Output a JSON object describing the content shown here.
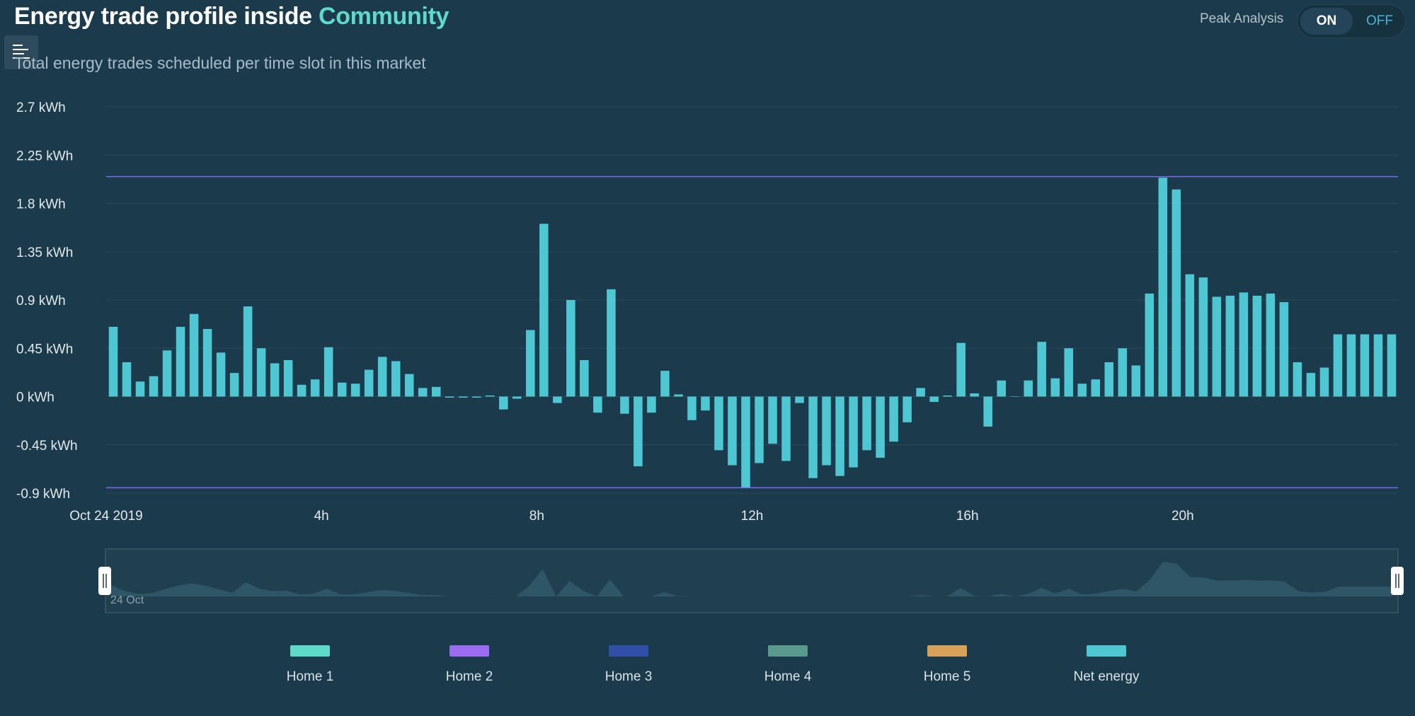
{
  "header": {
    "title_prefix": "Energy trade profile inside",
    "title_community": "Community",
    "subtitle": "Total energy trades scheduled per time slot in this market"
  },
  "peak_analysis": {
    "label": "Peak Analysis",
    "on_label": "ON",
    "off_label": "OFF",
    "state": "ON"
  },
  "colors": {
    "background": "#1b3a4b",
    "net_energy": "#4fc7d2",
    "peak_line": "#7c6cf2",
    "title_accent": "#5fd9c8"
  },
  "icons": {
    "menu": "menu-icon"
  },
  "chart_data": {
    "type": "bar",
    "title": "",
    "xlabel": "",
    "ylabel": "",
    "ylim": [
      -0.9,
      2.7
    ],
    "y_ticks": [
      "2.7 kWh",
      "2.25 kWh",
      "1.8 kWh",
      "1.35 kWh",
      "0.9 kWh",
      "0.45 kWh",
      "0 kWh",
      "-0.45 kWh",
      "-0.9 kWh"
    ],
    "y_tick_values": [
      2.7,
      2.25,
      1.8,
      1.35,
      0.9,
      0.45,
      0,
      -0.45,
      -0.9
    ],
    "x_ticks": [
      "Oct 24 2019",
      "4h",
      "8h",
      "12h",
      "16h",
      "20h"
    ],
    "x_tick_hours": [
      0,
      4,
      8,
      12,
      16,
      20
    ],
    "x_range_hours": [
      0,
      24
    ],
    "peak_lines": [
      2.05,
      -0.85
    ],
    "grid": true,
    "legend_position": "bottom",
    "series": [
      {
        "name": "Net energy",
        "start_hour": 0,
        "slot_hours": 0.25,
        "values": [
          0.65,
          0.32,
          0.14,
          0.19,
          0.43,
          0.65,
          0.77,
          0.63,
          0.41,
          0.22,
          0.84,
          0.45,
          0.31,
          0.34,
          0.11,
          0.16,
          0.46,
          0.13,
          0.12,
          0.25,
          0.37,
          0.33,
          0.21,
          0.08,
          0.09,
          -0.01,
          -0.01,
          -0.01,
          0.01,
          -0.12,
          -0.02,
          0.62,
          1.61,
          -0.06,
          0.9,
          0.34,
          -0.15,
          1.0,
          -0.16,
          -0.65,
          -0.15,
          0.24,
          0.02,
          -0.22,
          -0.13,
          -0.5,
          -0.64,
          -0.85,
          -0.62,
          -0.44,
          -0.6,
          -0.06,
          -0.76,
          -0.64,
          -0.74,
          -0.66,
          -0.5,
          -0.57,
          -0.42,
          -0.24,
          0.08,
          -0.05,
          0.01,
          0.5,
          0.03,
          -0.28,
          0.15,
          0,
          0.15,
          0.51,
          0.17,
          0.45,
          0.12,
          0.16,
          0.32,
          0.45,
          0.29,
          0.96,
          2.04,
          1.93,
          1.14,
          1.11,
          0.93,
          0.94,
          0.97,
          0.94,
          0.96,
          0.88,
          0.32,
          0.22,
          0.27,
          0.58,
          0.58,
          0.58,
          0.58,
          0.58
        ]
      }
    ],
    "navigator_label": "24 Oct"
  },
  "legend": [
    {
      "label": "Home 1",
      "color": "#5fd9c8"
    },
    {
      "label": "Home 2",
      "color": "#9b6cf0"
    },
    {
      "label": "Home 3",
      "color": "#2f4fa8"
    },
    {
      "label": "Home 4",
      "color": "#5a9a8e"
    },
    {
      "label": "Home 5",
      "color": "#d8a15a"
    },
    {
      "label": "Net energy",
      "color": "#4fc7d2"
    }
  ]
}
